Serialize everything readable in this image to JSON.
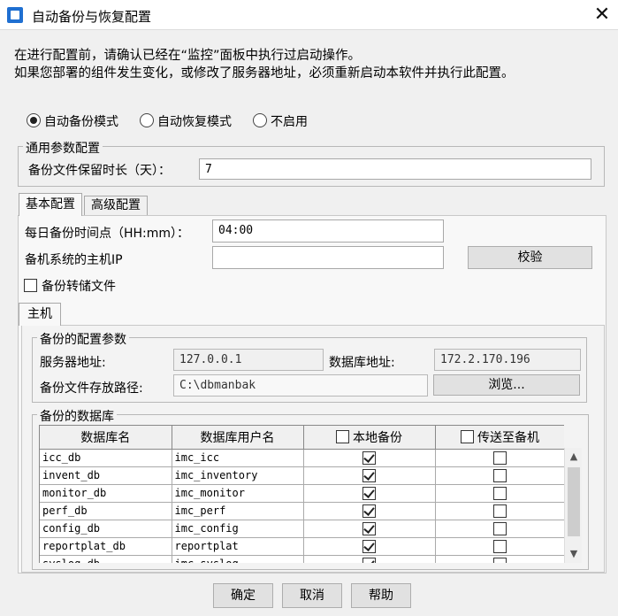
{
  "window": {
    "title": "自动备份与恢复配置",
    "close": "✕"
  },
  "intro": {
    "line1": "在进行配置前，请确认已经在“监控”面板中执行过启动操作。",
    "line2": "如果您部署的组件发生变化，或修改了服务器地址，必须重新启动本软件并执行此配置。"
  },
  "modes": [
    {
      "label": "自动备份模式",
      "selected": true
    },
    {
      "label": "自动恢复模式",
      "selected": false
    },
    {
      "label": "不启用",
      "selected": false
    }
  ],
  "general": {
    "title": "通用参数配置",
    "retention_label": "备份文件保留时长（天）：",
    "retention_value": "7"
  },
  "tabs": [
    {
      "label": "基本配置",
      "selected": true
    },
    {
      "label": "高级配置",
      "selected": false
    }
  ],
  "basic": {
    "time_label": "每日备份时间点（HH:mm）：",
    "time_value": "04:00",
    "standby_ip_label": "备机系统的主机IP",
    "standby_ip_value": "",
    "verify_button": "校验",
    "dump_label": "备份转储文件",
    "dump_checked": false
  },
  "subtab": {
    "label": "主机"
  },
  "config_params": {
    "title": "备份的配置参数",
    "server_label": "服务器地址:",
    "server_value": "127.0.0.1",
    "db_addr_label": "数据库地址:",
    "db_addr_value": "172.2.170.196",
    "path_label": "备份文件存放路径:",
    "path_value": "C:\\dbmanbak",
    "browse_button": "浏览..."
  },
  "databases": {
    "title": "备份的数据库",
    "columns": {
      "name": "数据库名",
      "user": "数据库用户名",
      "local": "本地备份",
      "send": "传送至备机"
    },
    "rows": [
      {
        "name": "icc_db",
        "user": "imc_icc",
        "local": true,
        "send": false
      },
      {
        "name": "invent_db",
        "user": "imc_inventory",
        "local": true,
        "send": false
      },
      {
        "name": "monitor_db",
        "user": "imc_monitor",
        "local": true,
        "send": false
      },
      {
        "name": "perf_db",
        "user": "imc_perf",
        "local": true,
        "send": false
      },
      {
        "name": "config_db",
        "user": "imc_config",
        "local": true,
        "send": false
      },
      {
        "name": "reportplat_db",
        "user": "reportplat",
        "local": true,
        "send": false
      },
      {
        "name": "syslog_db",
        "user": "imc_syslog",
        "local": true,
        "send": false
      }
    ]
  },
  "footer": {
    "ok": "确定",
    "cancel": "取消",
    "help": "帮助"
  }
}
